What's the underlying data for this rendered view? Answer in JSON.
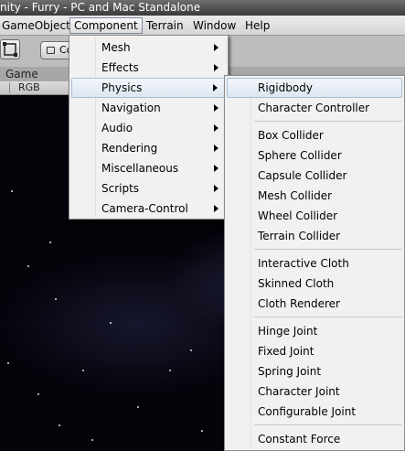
{
  "window": {
    "title": "nity - Furry - PC and Mac Standalone"
  },
  "menubar": {
    "items": [
      {
        "label": "GameObject"
      },
      {
        "label": "Component"
      },
      {
        "label": "Terrain"
      },
      {
        "label": "Window"
      },
      {
        "label": "Help"
      }
    ]
  },
  "toolbar": {
    "toggle_label": "Co"
  },
  "game_panel": {
    "tab_label": "Game",
    "display_mode": "RGB"
  },
  "component_menu": {
    "items": [
      {
        "label": "Mesh",
        "submenu": true
      },
      {
        "label": "Effects",
        "submenu": true
      },
      {
        "label": "Physics",
        "submenu": true,
        "highlighted": true
      },
      {
        "label": "Navigation",
        "submenu": true
      },
      {
        "label": "Audio",
        "submenu": true
      },
      {
        "label": "Rendering",
        "submenu": true
      },
      {
        "label": "Miscellaneous",
        "submenu": true
      },
      {
        "label": "Scripts",
        "submenu": true
      },
      {
        "label": "Camera-Control",
        "submenu": true
      }
    ]
  },
  "physics_menu": {
    "groups": [
      [
        "Rigidbody",
        "Character Controller"
      ],
      [
        "Box Collider",
        "Sphere Collider",
        "Capsule Collider",
        "Mesh Collider",
        "Wheel Collider",
        "Terrain Collider"
      ],
      [
        "Interactive Cloth",
        "Skinned Cloth",
        "Cloth Renderer"
      ],
      [
        "Hinge Joint",
        "Fixed Joint",
        "Spring Joint",
        "Character Joint",
        "Configurable Joint"
      ],
      [
        "Constant Force"
      ]
    ],
    "highlighted": "Rigidbody"
  },
  "colors": {
    "menu_bg": "#f1f1f1",
    "highlight_border": "#a8bcd6",
    "game_bg": "#03030a"
  }
}
